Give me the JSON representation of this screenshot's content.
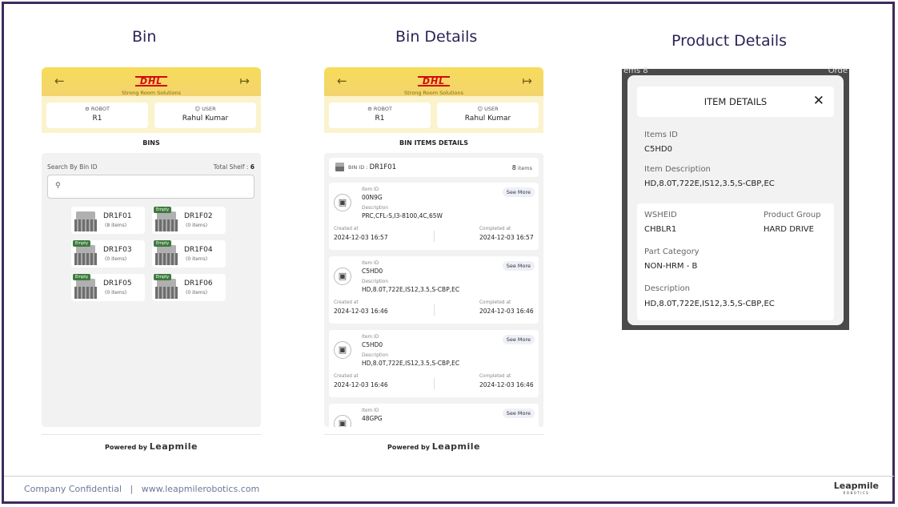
{
  "sections": {
    "bin_title": "Bin",
    "bin_details_title": "Bin Details",
    "product_details_title": "Product Details"
  },
  "app": {
    "brand": "DHL",
    "subtitle": "Strong Room Solutions",
    "robot_label": "ROBOT",
    "robot_value": "R1",
    "user_label": "USER",
    "user_value": "Rahul Kumar",
    "powered_by": "Powered by",
    "powered_logo": "Leapmile",
    "powered_logo_sub": "ROBOTICS"
  },
  "bin_screen": {
    "heading": "BINS",
    "search_label": "Search By Bin ID",
    "total_shelf_label": "Total Shelf :",
    "total_shelf_value": "6",
    "bins": [
      {
        "name": "DR1F01",
        "count": "(8 items)",
        "empty": ""
      },
      {
        "name": "DR1F02",
        "count": "(0 items)",
        "empty": "Empty"
      },
      {
        "name": "DR1F03",
        "count": "(0 items)",
        "empty": "Empty"
      },
      {
        "name": "DR1F04",
        "count": "(0 items)",
        "empty": "Empty"
      },
      {
        "name": "DR1F05",
        "count": "(0 items)",
        "empty": "Empty"
      },
      {
        "name": "DR1F06",
        "count": "(0 items)",
        "empty": "Empty"
      }
    ]
  },
  "bin_details_screen": {
    "heading": "BIN ITEMS DETAILS",
    "bin_id_label": "BIN ID :",
    "bin_id_value": "DR1F01",
    "item_count": "8",
    "item_count_label": "items",
    "item_id_label": "Item ID",
    "description_label": "Description",
    "created_label": "Created at",
    "completed_label": "Completed at",
    "see_more": "See More",
    "items": [
      {
        "id": "00N9G",
        "description": "PRC,CFL-S,I3-8100,4C,65W",
        "created": "2024-12-03 16:57",
        "completed": "2024-12-03 16:57"
      },
      {
        "id": "C5HD0",
        "description": "HD,8.0T,722E,IS12,3.5,S-CBP,EC",
        "created": "2024-12-03 16:46",
        "completed": "2024-12-03 16:46"
      },
      {
        "id": "C5HD0",
        "description": "HD,8.0T,722E,IS12,3.5,S-CBP,EC",
        "created": "2024-12-03 16:46",
        "completed": "2024-12-03 16:46"
      },
      {
        "id": "48GPG",
        "description": "",
        "created": "",
        "completed": ""
      }
    ]
  },
  "product_details": {
    "title": "ITEM DETAILS",
    "background_text_left": "ems 8",
    "background_text_right": "Orde",
    "items_id_label": "Items ID",
    "items_id_value": "C5HD0",
    "item_description_label": "Item Description",
    "item_description_value": "HD,8.0T,722E,IS12,3.5,S-CBP,EC",
    "wsheid_label": "WSHEID",
    "wsheid_value": "CHBLR1",
    "product_group_label": "Product Group",
    "product_group_value": "HARD DRIVE",
    "part_category_label": "Part Category",
    "part_category_value": "NON-HRM - B",
    "description_label": "Description",
    "description_value": "HD,8.0T,722E,IS12,3.5,S-CBP,EC"
  },
  "footer": {
    "text": "Company Confidential   |   www.leapmilerobotics.com",
    "logo": "Leapmile",
    "logo_sub": "ROBOTICS"
  },
  "colors": {
    "header_yellow": "#f7dc5a",
    "dhl_red": "#d40511",
    "empty_green": "#3d7a3d",
    "frame_purple": "#3d2a5c",
    "title_navy": "#2b2358"
  }
}
